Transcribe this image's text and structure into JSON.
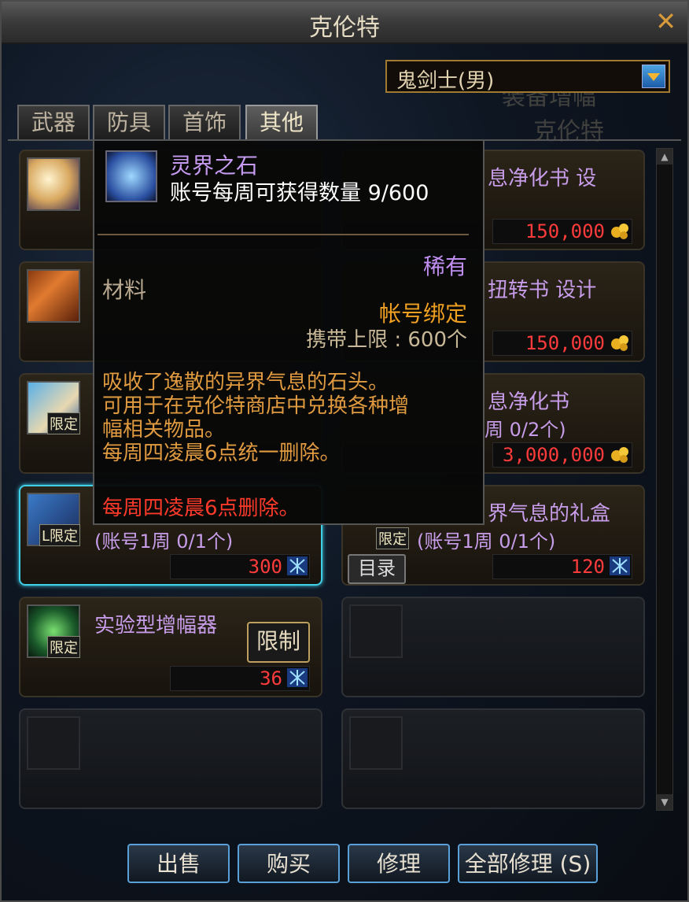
{
  "window": {
    "title": "克伦特"
  },
  "background_text": {
    "line1": "装备增幅",
    "line2": "克伦特"
  },
  "job_select": {
    "value": "鬼剑士(男)"
  },
  "tabs": [
    {
      "label": "武器"
    },
    {
      "label": "防具"
    },
    {
      "label": "首饰"
    },
    {
      "label": "其他"
    }
  ],
  "items": {
    "r1c2": {
      "name": "息净化书  设",
      "price": "150,000"
    },
    "r2c2": {
      "name": "扭转书  设计",
      "price": "150,000"
    },
    "r3c1": {
      "badge": "限定"
    },
    "r3c2": {
      "name": "息净化书",
      "sub": "周 0/2个)",
      "price": "3,000,000"
    },
    "r4c1": {
      "badge": "L限定",
      "sub": "(账号1周 0/1个)",
      "price": "300"
    },
    "r4c2": {
      "name": "界气息的礼盒",
      "sub": "(账号1周 0/1个)",
      "badge": "限定",
      "category_button": "目录",
      "price": "120"
    },
    "r5c1": {
      "name": "实验型增幅器",
      "badge": "限定",
      "limit_button": "限制",
      "price": "36"
    }
  },
  "tooltip": {
    "name": "灵界之石",
    "weekly": "账号每周可获得数量 9/600",
    "rarity": "稀有",
    "type": "材料",
    "bind": "帐号绑定",
    "carry_limit": "携带上限 : 600个",
    "desc1": "吸收了逸散的异界气息的石头。",
    "desc2": "可用于在克伦特商店中兑换各种增",
    "desc3": "幅相关物品。",
    "desc4": "每周四凌晨6点统一删除。",
    "delete_note": "每周四凌晨6点删除。"
  },
  "buttons": {
    "sell": "出售",
    "buy": "购买",
    "repair": "修理",
    "repair_all": "全部修理 (S)"
  },
  "colors": {
    "accent": "#3fd0e8",
    "price": "#ff3b3b",
    "rare": "#c59af0",
    "bind": "#f0a020"
  }
}
